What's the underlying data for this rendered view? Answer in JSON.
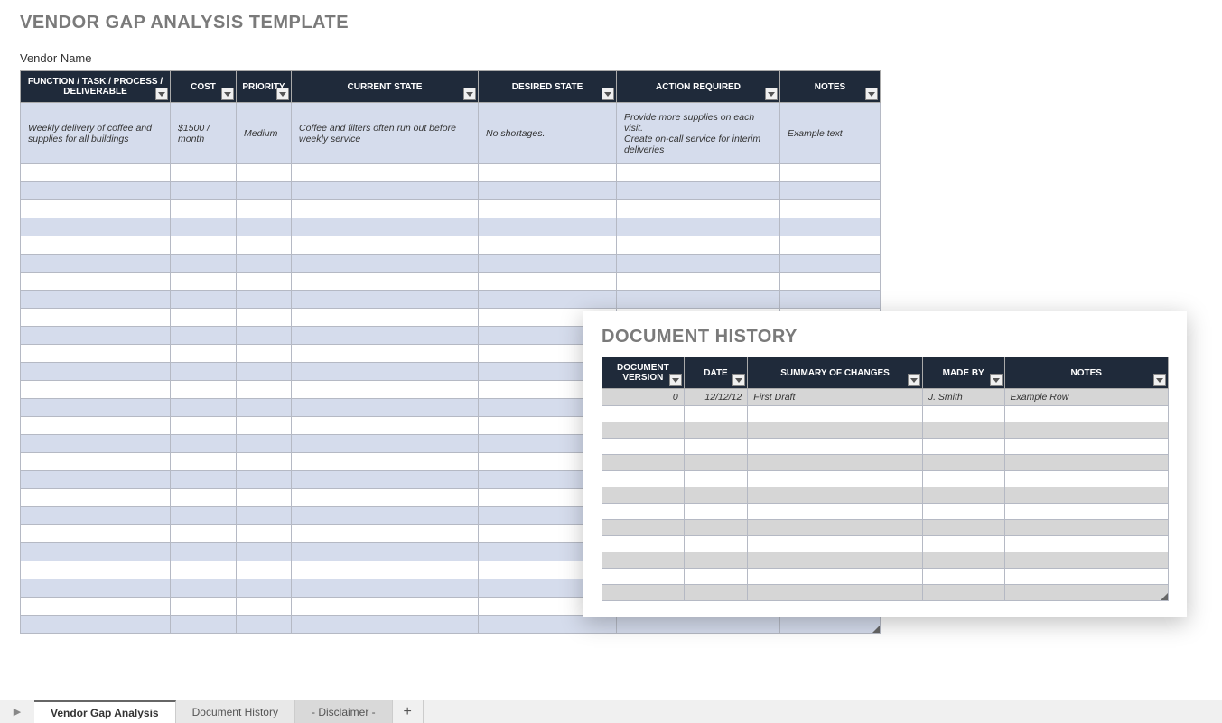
{
  "title": "VENDOR GAP ANALYSIS TEMPLATE",
  "vendor_label": "Vendor Name",
  "main": {
    "headers": {
      "func": "FUNCTION / TASK / PROCESS / DELIVERABLE",
      "cost": "COST",
      "priority": "PRIORITY",
      "current": "CURRENT STATE",
      "desired": "DESIRED STATE",
      "action": "ACTION REQUIRED",
      "notes": "NOTES"
    },
    "row": {
      "func": "Weekly delivery of coffee and supplies for all buildings",
      "cost": "$1500 / month",
      "priority": "Medium",
      "current": "Coffee and filters often run out before weekly service",
      "desired": "No shortages.",
      "action": "Provide more supplies on each visit.\nCreate on-call service for interim deliveries",
      "notes": "Example text"
    }
  },
  "history": {
    "title": "DOCUMENT HISTORY",
    "headers": {
      "version": "DOCUMENT VERSION",
      "date": "DATE",
      "summary": "SUMMARY OF CHANGES",
      "madeby": "MADE BY",
      "notes": "NOTES"
    },
    "row": {
      "version": "0",
      "date": "12/12/12",
      "summary": "First Draft",
      "madeby": "J. Smith",
      "notes": "Example Row"
    }
  },
  "tabs": {
    "t1": "Vendor Gap Analysis",
    "t2": "Document History",
    "t3": "- Disclaimer -"
  }
}
